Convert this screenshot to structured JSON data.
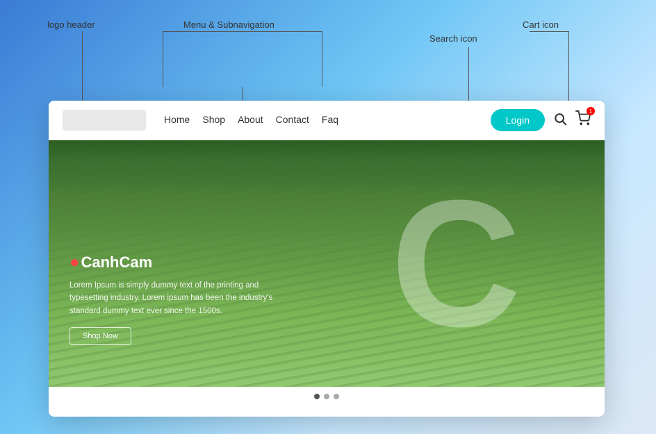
{
  "annotations": {
    "logo_label": "logo header",
    "menu_label": "Menu & Subnavigation",
    "search_label": "Search icon",
    "cart_label": "Cart icon"
  },
  "navbar": {
    "logo_alt": "Logo",
    "nav_links": [
      {
        "label": "Home",
        "active": false
      },
      {
        "label": "Shop",
        "active": false
      },
      {
        "label": "About",
        "active": false
      },
      {
        "label": "Contact",
        "active": false
      },
      {
        "label": "Faq",
        "active": false
      }
    ],
    "login_label": "Login",
    "search_icon": "🔍",
    "cart_icon": "🛒",
    "cart_count": "1"
  },
  "hero": {
    "brand_name": "CanhCam",
    "description": "Lorem Ipsum is simply dummy text of the printing and typesetting industry. Lorem ipsum has been the industry's standard dummy text ever since the 1500s.",
    "cta_label": "Shop Now",
    "letter": "C"
  },
  "pagination": {
    "dots": [
      {
        "active": true
      },
      {
        "active": false
      },
      {
        "active": false
      }
    ]
  }
}
